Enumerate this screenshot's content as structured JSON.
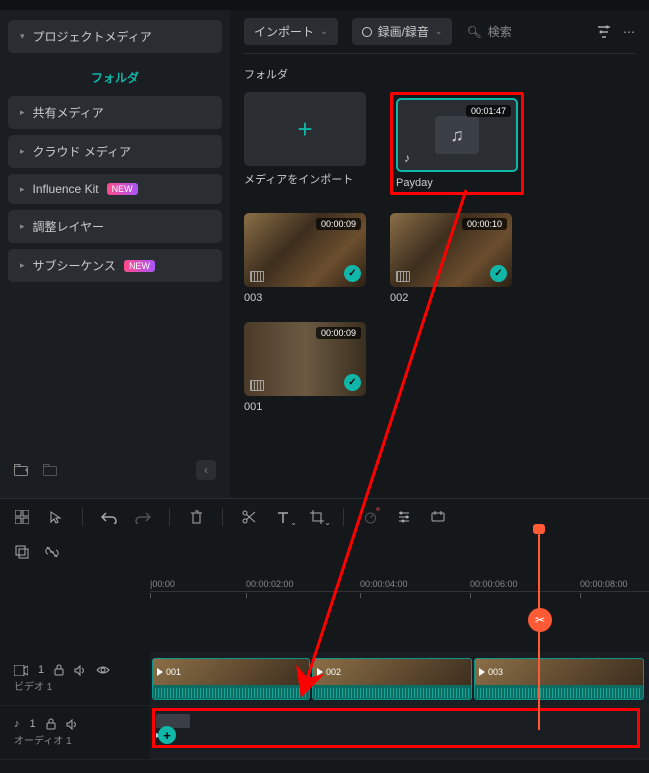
{
  "sidebar": {
    "header": "プロジェクトメディア",
    "folder_tab": "フォルダ",
    "items": [
      {
        "label": "共有メディア",
        "badge": null
      },
      {
        "label": "クラウド メディア",
        "badge": null
      },
      {
        "label": "Influence Kit",
        "badge": "NEW"
      },
      {
        "label": "調整レイヤー",
        "badge": null
      },
      {
        "label": "サブシーケンス",
        "badge": "NEW"
      }
    ]
  },
  "toolbar_top": {
    "import": "インポート",
    "record": "録画/録音",
    "search_placeholder": "検索"
  },
  "folder_heading": "フォルダ",
  "media": {
    "import_label": "メディアをインポート",
    "items": [
      {
        "name": "Payday",
        "duration": "00:01:47",
        "type": "audio",
        "selected": true
      },
      {
        "name": "003",
        "duration": "00:00:09",
        "type": "video",
        "checked": true
      },
      {
        "name": "002",
        "duration": "00:00:10",
        "type": "video",
        "checked": true
      },
      {
        "name": "001",
        "duration": "00:00:09",
        "type": "video",
        "checked": true
      }
    ]
  },
  "timeline": {
    "ticks": [
      "|00:00",
      "00:00:02:00",
      "00:00:04:00",
      "00:00:06:00",
      "00:00:08:00"
    ],
    "video_track_label": "ビデオ 1",
    "audio_track_label": "オーディオ 1",
    "clips": [
      {
        "name": "001"
      },
      {
        "name": "002"
      },
      {
        "name": "003"
      }
    ]
  }
}
